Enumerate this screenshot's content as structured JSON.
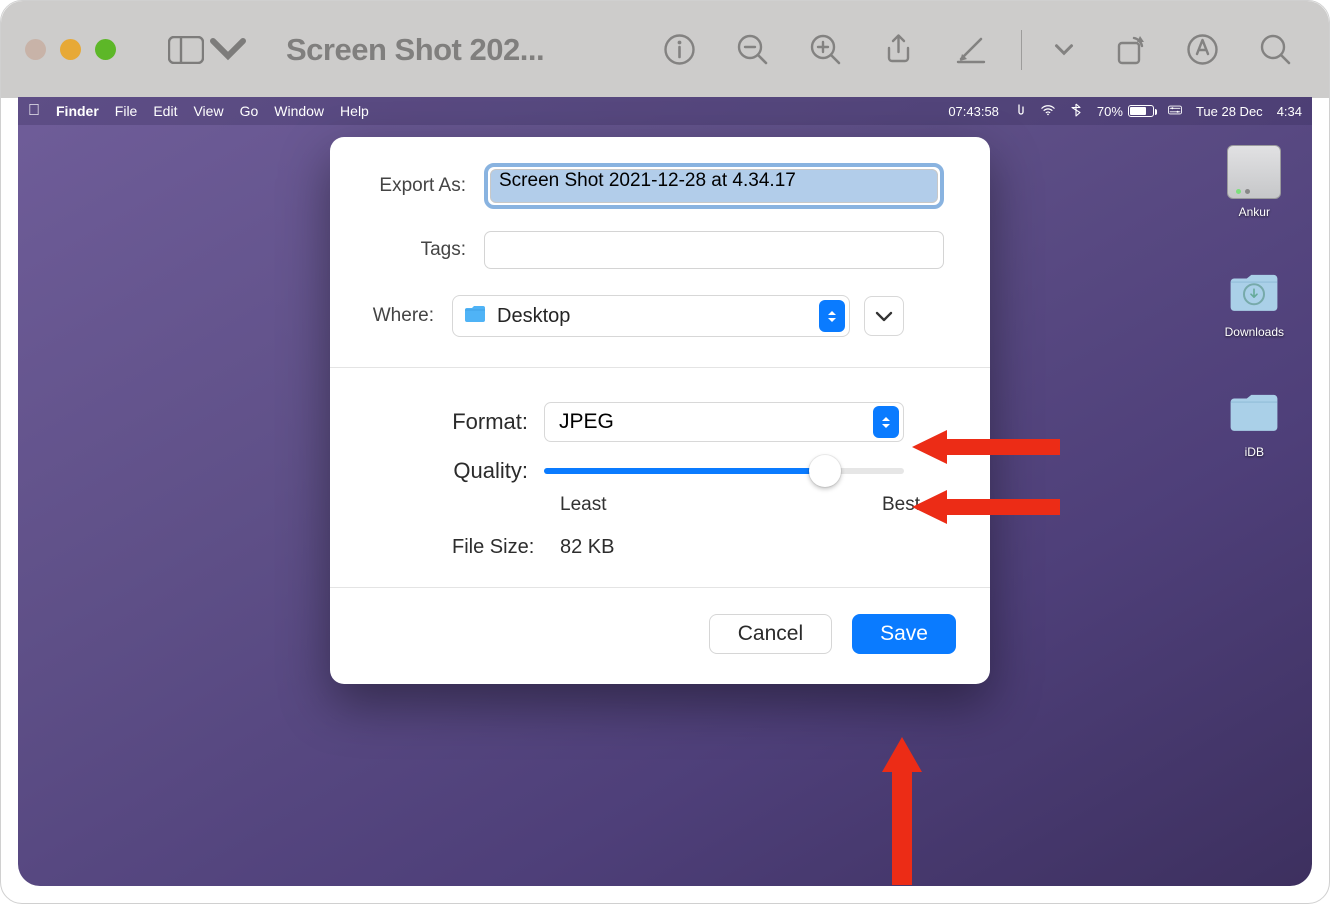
{
  "outer_window": {
    "title": "Screen Shot 202..."
  },
  "menubar": {
    "app": "Finder",
    "items": [
      "File",
      "Edit",
      "View",
      "Go",
      "Window",
      "Help"
    ],
    "time1": "07:43:58",
    "battery": "70%",
    "date": "Tue 28 Dec",
    "time2": "4:34"
  },
  "desktop_icons": {
    "hdd": "Ankur",
    "downloads": "Downloads",
    "idb": "iDB"
  },
  "dialog": {
    "export_as_label": "Export As:",
    "filename": "Screen Shot 2021-12-28 at 4.34.17",
    "tags_label": "Tags:",
    "where_label": "Where:",
    "where_value": "Desktop",
    "format_label": "Format:",
    "format_value": "JPEG",
    "quality_label": "Quality:",
    "quality_least": "Least",
    "quality_best": "Best",
    "filesize_label": "File Size:",
    "filesize_value": "82 KB",
    "cancel": "Cancel",
    "save": "Save"
  },
  "colors": {
    "accent": "#0a7bff",
    "arrow": "#ec2c16"
  }
}
